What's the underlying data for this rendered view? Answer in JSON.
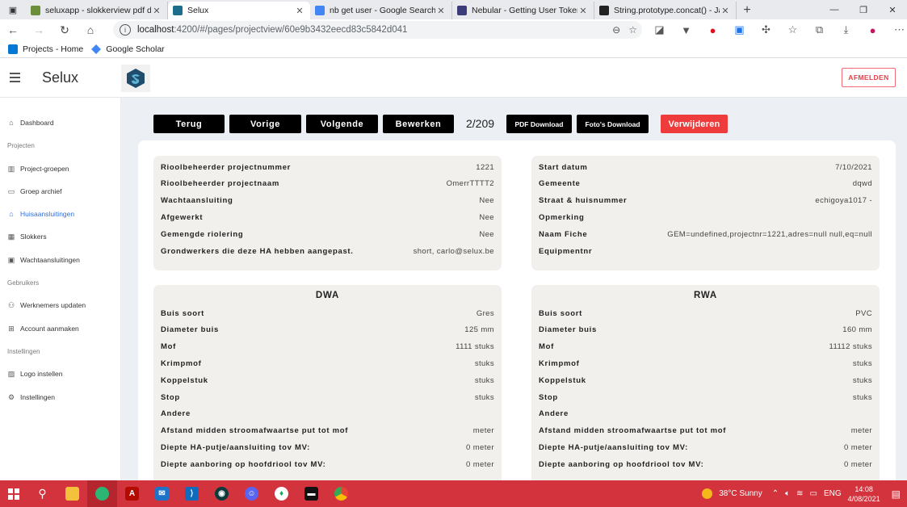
{
  "browser": {
    "tabs": [
      {
        "title": "seluxapp - slokkerview pdf down",
        "fav": "#6b8e3a",
        "active": false
      },
      {
        "title": "Selux",
        "fav": "#1c6e8c",
        "active": true
      },
      {
        "title": "nb get user - Google Search",
        "fav": "#4285f4",
        "active": false
      },
      {
        "title": "Nebular - Getting User Token",
        "fav": "#3c3c7a",
        "active": false
      },
      {
        "title": "String.prototype.concat() - JavaS",
        "fav": "#222222",
        "active": false
      }
    ],
    "url_host": "localhost",
    "url_path": ":4200/#/pages/projectview/60e9b3432eecd83c5842d041",
    "bookmarks": [
      "Projects - Home",
      "Google Scholar"
    ]
  },
  "app": {
    "brand": "Selux",
    "logout": "AFMELDEN"
  },
  "sidebar": {
    "items": [
      {
        "label": "Dashboard",
        "icon": "home-icon",
        "glyph": "⌂"
      },
      {
        "header": "Projecten"
      },
      {
        "label": "Project-groepen",
        "icon": "columns-icon",
        "glyph": "▥"
      },
      {
        "label": "Groep archief",
        "icon": "archive-icon",
        "glyph": "▭"
      },
      {
        "label": "Huisaansluitingen",
        "icon": "home-icon",
        "glyph": "⌂",
        "active": true
      },
      {
        "label": "Slokkers",
        "icon": "grid-icon",
        "glyph": "▦"
      },
      {
        "label": "Wachtaansluitingen",
        "icon": "layout-icon",
        "glyph": "▣"
      },
      {
        "header": "Gebruikers"
      },
      {
        "label": "Werknemers updaten",
        "icon": "people-icon",
        "glyph": "⚇"
      },
      {
        "label": "Account aanmaken",
        "icon": "plus-square-icon",
        "glyph": "⊞"
      },
      {
        "header": "Instellingen"
      },
      {
        "label": "Logo instellen",
        "icon": "image-icon",
        "glyph": "▨"
      },
      {
        "label": "Instellingen",
        "icon": "gear-icon",
        "glyph": "⚙"
      }
    ]
  },
  "toolbar": {
    "back": "Terug",
    "prev": "Vorige",
    "next": "Volgende",
    "edit": "Bewerken",
    "counter": "2/209",
    "pdf": "PDF Download",
    "photos": "Foto's Download",
    "delete": "Verwijderen"
  },
  "info_left": [
    {
      "label": "Rioolbeheerder projectnummer",
      "value": "1221"
    },
    {
      "label": "Rioolbeheerder projectnaam",
      "value": "OmerrTTTT2"
    },
    {
      "label": "Wachtaansluiting",
      "value": "Nee"
    },
    {
      "label": "Afgewerkt",
      "value": "Nee"
    },
    {
      "label": "Gemengde riolering",
      "value": "Nee"
    },
    {
      "label": "Grondwerkers die deze HA hebben aangepast.",
      "value": "short, carlo@selux.be"
    }
  ],
  "info_right": [
    {
      "label": "Start datum",
      "value": "7/10/2021"
    },
    {
      "label": "Gemeente",
      "value": "dqwd"
    },
    {
      "label": "Straat & huisnummer",
      "value": "echigoya1017 -"
    },
    {
      "label": "Opmerking",
      "value": ""
    },
    {
      "label": "Naam Fiche",
      "value": "GEM=undefined,projectnr=1221,adres=null null,eq=null"
    },
    {
      "label": "Equipmentnr",
      "value": ""
    }
  ],
  "dwa": {
    "title": "DWA",
    "rows": [
      {
        "label": "Buis soort",
        "value": "Gres"
      },
      {
        "label": "Diameter buis",
        "value": "125 mm"
      },
      {
        "label": "Mof",
        "value": "1111 stuks"
      },
      {
        "label": "Krimpmof",
        "value": "stuks"
      },
      {
        "label": "Koppelstuk",
        "value": "stuks"
      },
      {
        "label": "Stop",
        "value": "stuks"
      },
      {
        "label": "Andere",
        "value": ""
      },
      {
        "label": "Afstand midden stroomafwaartse put tot mof",
        "value": "meter"
      },
      {
        "label": "Diepte HA-putje/aansluiting tov MV:",
        "value": "0 meter"
      },
      {
        "label": "Diepte aanboring op hoofdriool tov MV:",
        "value": "0 meter"
      }
    ]
  },
  "rwa": {
    "title": "RWA",
    "rows": [
      {
        "label": "Buis soort",
        "value": "PVC"
      },
      {
        "label": "Diameter buis",
        "value": "160 mm"
      },
      {
        "label": "Mof",
        "value": "11112 stuks"
      },
      {
        "label": "Krimpmof",
        "value": "stuks"
      },
      {
        "label": "Koppelstuk",
        "value": "stuks"
      },
      {
        "label": "Stop",
        "value": "stuks"
      },
      {
        "label": "Andere",
        "value": ""
      },
      {
        "label": "Afstand midden stroomafwaartse put tot mof",
        "value": "meter"
      },
      {
        "label": "Diepte HA-putje/aansluiting tov MV:",
        "value": "0 meter"
      },
      {
        "label": "Diepte aanboring op hoofdriool tov MV:",
        "value": "0 meter"
      }
    ]
  },
  "taskbar": {
    "weather": "38°C  Sunny",
    "lang": "ENG",
    "time": "14:08",
    "date": "4/08/2021"
  },
  "colors": {
    "accent_blue": "#2f6fd6",
    "delete_red": "#ee3b3b",
    "taskbar_red": "#d2333c"
  }
}
